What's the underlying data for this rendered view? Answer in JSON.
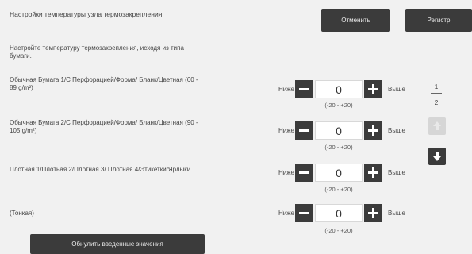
{
  "header": {
    "title": "Настройки температуры узла термозакрепления",
    "description": "Настройте температуру термозакрепления, исходя из типа бумаги.",
    "cancel_label": "Отменить",
    "register_label": "Регистр"
  },
  "rows": [
    {
      "label": "Обычная Бумага 1/С Перфорацией/Форма/ Бланк/Цветная (60 - 89 g/m²)",
      "low": "Ниже",
      "value": "0",
      "high": "Выше",
      "range": "(-20 - +20)"
    },
    {
      "label": "Обычная Бумага 2/С Перфорацией/Форма/ Бланк/Цветная (90 - 105 g/m²)",
      "low": "Ниже",
      "value": "0",
      "high": "Выше",
      "range": "(-20 - +20)"
    },
    {
      "label": "Плотная 1/Плотная 2/Плотная 3/ Плотная 4/Этикетки/Ярлыки",
      "low": "Ниже",
      "value": "0",
      "high": "Выше",
      "range": "(-20 - +20)"
    },
    {
      "label": "(Тонкая)",
      "low": "Ниже",
      "value": "0",
      "high": "Выше",
      "range": "(-20 - +20)"
    }
  ],
  "pagination": {
    "current": "1",
    "total": "2",
    "up_icon": "arrow-up-icon",
    "down_icon": "arrow-down-icon"
  },
  "footer": {
    "reset_label": "Обнулить введенные значения"
  },
  "colors": {
    "background": "#f1f1f1",
    "button": "#3b3b3b",
    "disabled": "#d6d6d6"
  }
}
